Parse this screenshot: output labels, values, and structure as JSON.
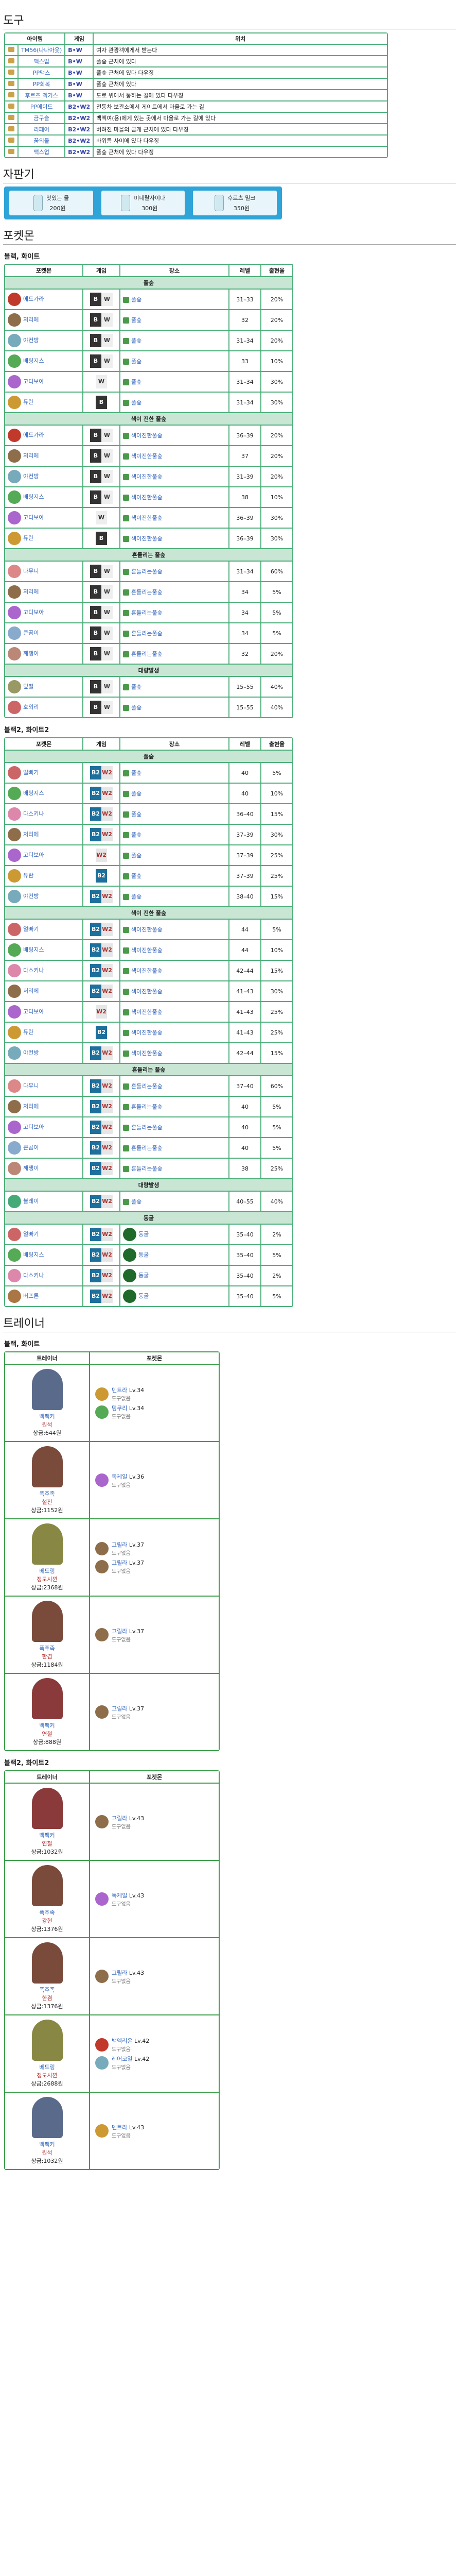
{
  "sections": {
    "items": "도구",
    "vending": "자판기",
    "pokemon": "포켓몬",
    "trainers": "트레이너"
  },
  "items": {
    "headers": [
      "아이템",
      "게임",
      "위치"
    ],
    "rows": [
      {
        "name": "TM56(나나아웃)",
        "game": "B•W",
        "loc": "여자 관광객에게서 받는다"
      },
      {
        "name": "맥스업",
        "game": "B•W",
        "loc": "풀숲 근처에 있다"
      },
      {
        "name": "PP맥스",
        "game": "B•W",
        "loc": "풀숲 근처에 있다 다우징"
      },
      {
        "name": "PP회복",
        "game": "B•W",
        "loc": "풀숲 근처에 있다"
      },
      {
        "name": "후르츠 엑기스",
        "game": "B•W",
        "loc": "도로 위에서 통하는 길에 있다 다우징"
      },
      {
        "name": "PP에이드",
        "game": "B2•W2",
        "loc": "전동차 보관소에서 게이트에서 마을로 가는 길"
      },
      {
        "name": "금구슬",
        "game": "B2•W2",
        "loc": "백엑여(용)에게 있는 곳에서 마을로 가는 길에 있다"
      },
      {
        "name": "리페어",
        "game": "B2•W2",
        "loc": "버려진 마을의 금개 근처에 있다 다우징"
      },
      {
        "name": "꿈의물",
        "game": "B2•W2",
        "loc": "바위틈 사이에 있다 다우징"
      },
      {
        "name": "맥스업",
        "game": "B2•W2",
        "loc": "풀숲 근처에 있다 다우징"
      }
    ]
  },
  "vending": [
    {
      "name": "맛있는 물",
      "price": "200원"
    },
    {
      "name": "미네랄사이다",
      "price": "300원"
    },
    {
      "name": "후르츠 밀크",
      "price": "350원"
    }
  ],
  "bw": {
    "title": "블랙, 화이트",
    "headers": [
      "포켓몬",
      "게임",
      "장소",
      "레벨",
      "출현율"
    ],
    "categories": [
      "풀숲",
      "색이 진한 풀숲",
      "흔들리는 풀숲",
      "대량발생"
    ],
    "rows": [
      {
        "cat": 0,
        "name": "에드가라",
        "game": "B•W",
        "place": "풀숲",
        "lv": "31–33",
        "rate": "20%",
        "color": "#c0392b"
      },
      {
        "cat": 0,
        "name": "저리에",
        "game": "B•W",
        "place": "풀숲",
        "lv": "32",
        "rate": "20%",
        "color": "#8e6e4a"
      },
      {
        "cat": 0,
        "name": "야컨방",
        "game": "B•W",
        "place": "풀숲",
        "lv": "31–34",
        "rate": "20%",
        "color": "#7ab"
      },
      {
        "cat": 0,
        "name": "배팅지스",
        "game": "B•W",
        "place": "풀숲",
        "lv": "33",
        "rate": "10%",
        "color": "#5a5"
      },
      {
        "cat": 0,
        "name": "고디보아",
        "game": "W",
        "place": "풀숲",
        "lv": "31–34",
        "rate": "30%",
        "color": "#a6c"
      },
      {
        "cat": 0,
        "name": "듀란",
        "game": "B",
        "place": "풀숲",
        "lv": "31–34",
        "rate": "30%",
        "color": "#c93"
      },
      {
        "cat": 1,
        "name": "에드가라",
        "game": "B•W",
        "place": "색이진한풀숲",
        "lv": "36–39",
        "rate": "20%",
        "color": "#c0392b"
      },
      {
        "cat": 1,
        "name": "저리에",
        "game": "B•W",
        "place": "색이진한풀숲",
        "lv": "37",
        "rate": "20%",
        "color": "#8e6e4a"
      },
      {
        "cat": 1,
        "name": "야컨방",
        "game": "B•W",
        "place": "색이진한풀숲",
        "lv": "31–39",
        "rate": "20%",
        "color": "#7ab"
      },
      {
        "cat": 1,
        "name": "배팅지스",
        "game": "B•W",
        "place": "색이진한풀숲",
        "lv": "38",
        "rate": "10%",
        "color": "#5a5"
      },
      {
        "cat": 1,
        "name": "고디보아",
        "game": "W",
        "place": "색이진한풀숲",
        "lv": "36–39",
        "rate": "30%",
        "color": "#a6c"
      },
      {
        "cat": 1,
        "name": "듀란",
        "game": "B",
        "place": "색이진한풀숲",
        "lv": "36–39",
        "rate": "30%",
        "color": "#c93"
      },
      {
        "cat": 2,
        "name": "다무니",
        "game": "B•W",
        "place": "흔들리는풀숲",
        "lv": "31–34",
        "rate": "60%",
        "color": "#d88"
      },
      {
        "cat": 2,
        "name": "저리에",
        "game": "B•W",
        "place": "흔들리는풀숲",
        "lv": "34",
        "rate": "5%",
        "color": "#8e6e4a"
      },
      {
        "cat": 2,
        "name": "고디보아",
        "game": "B•W",
        "place": "흔들리는풀숲",
        "lv": "34",
        "rate": "5%",
        "color": "#a6c"
      },
      {
        "cat": 2,
        "name": "큰곰이",
        "game": "B•W",
        "place": "흔들리는풀숲",
        "lv": "34",
        "rate": "5%",
        "color": "#8ac"
      },
      {
        "cat": 2,
        "name": "깨쟁이",
        "game": "B•W",
        "place": "흔들리는풀숲",
        "lv": "32",
        "rate": "20%",
        "color": "#b87"
      },
      {
        "cat": 3,
        "name": "덮철",
        "game": "B•W",
        "place": "풀숲",
        "lv": "15–55",
        "rate": "40%",
        "color": "#996"
      },
      {
        "cat": 3,
        "name": "호외리",
        "game": "B•W",
        "place": "풀숲",
        "lv": "15–55",
        "rate": "40%",
        "color": "#c66"
      }
    ]
  },
  "b2w2": {
    "title": "블랙2, 화이트2",
    "headers": [
      "포켓몬",
      "게임",
      "장소",
      "레벨",
      "출현율"
    ],
    "categories": [
      "풀숲",
      "색이 진한 풀숲",
      "흔들리는 풀숲",
      "대량발생",
      "동굴"
    ],
    "rows": [
      {
        "cat": 0,
        "name": "얼빠기",
        "game": "B2•W2",
        "place": "풀숲",
        "lv": "40",
        "rate": "5%",
        "color": "#c66"
      },
      {
        "cat": 0,
        "name": "배팅지스",
        "game": "B2•W2",
        "place": "풀숲",
        "lv": "40",
        "rate": "10%",
        "color": "#5a5"
      },
      {
        "cat": 0,
        "name": "다스키나",
        "game": "B2•W2",
        "place": "풀숲",
        "lv": "36–40",
        "rate": "15%",
        "color": "#d8a"
      },
      {
        "cat": 0,
        "name": "저리에",
        "game": "B2•W2",
        "place": "풀숲",
        "lv": "37–39",
        "rate": "30%",
        "color": "#8e6e4a"
      },
      {
        "cat": 0,
        "name": "고디보아",
        "game": "W2",
        "place": "풀숲",
        "lv": "37–39",
        "rate": "25%",
        "color": "#a6c"
      },
      {
        "cat": 0,
        "name": "듀란",
        "game": "B2",
        "place": "풀숲",
        "lv": "37–39",
        "rate": "25%",
        "color": "#c93"
      },
      {
        "cat": 0,
        "name": "야컨방",
        "game": "B2•W2",
        "place": "풀숲",
        "lv": "38–40",
        "rate": "15%",
        "color": "#7ab"
      },
      {
        "cat": 1,
        "name": "얼빠기",
        "game": "B2•W2",
        "place": "색이진한풀숲",
        "lv": "44",
        "rate": "5%",
        "color": "#c66"
      },
      {
        "cat": 1,
        "name": "배팅지스",
        "game": "B2•W2",
        "place": "색이진한풀숲",
        "lv": "44",
        "rate": "10%",
        "color": "#5a5"
      },
      {
        "cat": 1,
        "name": "다스키나",
        "game": "B2•W2",
        "place": "색이진한풀숲",
        "lv": "42–44",
        "rate": "15%",
        "color": "#d8a"
      },
      {
        "cat": 1,
        "name": "저리에",
        "game": "B2•W2",
        "place": "색이진한풀숲",
        "lv": "41–43",
        "rate": "30%",
        "color": "#8e6e4a"
      },
      {
        "cat": 1,
        "name": "고디보아",
        "game": "W2",
        "place": "색이진한풀숲",
        "lv": "41–43",
        "rate": "25%",
        "color": "#a6c"
      },
      {
        "cat": 1,
        "name": "듀란",
        "game": "B2",
        "place": "색이진한풀숲",
        "lv": "41–43",
        "rate": "25%",
        "color": "#c93"
      },
      {
        "cat": 1,
        "name": "야컨방",
        "game": "B2•W2",
        "place": "색이진한풀숲",
        "lv": "42–44",
        "rate": "15%",
        "color": "#7ab"
      },
      {
        "cat": 2,
        "name": "다무니",
        "game": "B2•W2",
        "place": "흔들리는풀숲",
        "lv": "37–40",
        "rate": "60%",
        "color": "#d88"
      },
      {
        "cat": 2,
        "name": "저리에",
        "game": "B2•W2",
        "place": "흔들리는풀숲",
        "lv": "40",
        "rate": "5%",
        "color": "#8e6e4a"
      },
      {
        "cat": 2,
        "name": "고디보아",
        "game": "B2•W2",
        "place": "흔들리는풀숲",
        "lv": "40",
        "rate": "5%",
        "color": "#a6c"
      },
      {
        "cat": 2,
        "name": "큰곰이",
        "game": "B2•W2",
        "place": "흔들리는풀숲",
        "lv": "40",
        "rate": "5%",
        "color": "#8ac"
      },
      {
        "cat": 2,
        "name": "깨쟁이",
        "game": "B2•W2",
        "place": "흔들리는풀숲",
        "lv": "38",
        "rate": "25%",
        "color": "#b87"
      },
      {
        "cat": 3,
        "name": "블레이",
        "game": "B2•W2",
        "place": "풀숲",
        "lv": "40–55",
        "rate": "40%",
        "color": "#4a7"
      },
      {
        "cat": 4,
        "name": "얼빠기",
        "game": "B2•W2",
        "place": "동굴",
        "lv": "35–40",
        "rate": "2%",
        "color": "#c66"
      },
      {
        "cat": 4,
        "name": "배팅지스",
        "game": "B2•W2",
        "place": "동굴",
        "lv": "35–40",
        "rate": "5%",
        "color": "#5a5"
      },
      {
        "cat": 4,
        "name": "다스키나",
        "game": "B2•W2",
        "place": "동굴",
        "lv": "35–40",
        "rate": "2%",
        "color": "#d8a"
      },
      {
        "cat": 4,
        "name": "버프론",
        "game": "B2•W2",
        "place": "동굴",
        "lv": "35–40",
        "rate": "5%",
        "color": "#a74"
      }
    ]
  },
  "trainers_bw": {
    "title": "블랙, 화이트",
    "headers": [
      "트레이너",
      "포켓몬"
    ],
    "rows": [
      {
        "cls": "백팩커",
        "name": "원석",
        "prize": "상금:644원",
        "color": "#5a6a8a",
        "mons": [
          {
            "n": "덴트라",
            "lv": "Lv.34",
            "h": "도구없음",
            "c": "#c93"
          },
          {
            "n": "덩쿠리",
            "lv": "Lv.34",
            "h": "도구없음",
            "c": "#5a5"
          }
        ]
      },
      {
        "cls": "폭주족",
        "name": "철진",
        "prize": "상금:1152원",
        "color": "#7a4a3a",
        "mons": [
          {
            "n": "독케일",
            "lv": "Lv.36",
            "h": "도구없음",
            "c": "#a6c"
          }
        ]
      },
      {
        "cls": "베드링",
        "name": "정도시낀",
        "prize": "상금:2368원",
        "color": "#884",
        "mons": [
          {
            "n": "고릴라",
            "lv": "Lv.37",
            "h": "도구없음",
            "c": "#8e6e4a"
          },
          {
            "n": "고릴라",
            "lv": "Lv.37",
            "h": "도구없음",
            "c": "#8e6e4a"
          }
        ]
      },
      {
        "cls": "폭주족",
        "name": "한겸",
        "prize": "상금:1184원",
        "color": "#7a4a3a",
        "mons": [
          {
            "n": "고릴라",
            "lv": "Lv.37",
            "h": "도구없음",
            "c": "#8e6e4a"
          }
        ]
      },
      {
        "cls": "백팩커",
        "name": "연철",
        "prize": "상금:888원",
        "color": "#8a3a3a",
        "mons": [
          {
            "n": "고릴라",
            "lv": "Lv.37",
            "h": "도구없음",
            "c": "#8e6e4a"
          }
        ]
      }
    ]
  },
  "trainers_b2w2": {
    "title": "블랙2, 화이트2",
    "headers": [
      "트레이너",
      "포켓몬"
    ],
    "rows": [
      {
        "cls": "백팩커",
        "name": "연철",
        "prize": "상금:1032원",
        "color": "#8a3a3a",
        "mons": [
          {
            "n": "고릴라",
            "lv": "Lv.43",
            "h": "도구없음",
            "c": "#8e6e4a"
          }
        ]
      },
      {
        "cls": "폭주족",
        "name": "강현",
        "prize": "상금:1376원",
        "color": "#7a4a3a",
        "mons": [
          {
            "n": "독케일",
            "lv": "Lv.43",
            "h": "도구없음",
            "c": "#a6c"
          }
        ]
      },
      {
        "cls": "폭주족",
        "name": "한겸",
        "prize": "상금:1376원",
        "color": "#7a4a3a",
        "mons": [
          {
            "n": "고릴라",
            "lv": "Lv.43",
            "h": "도구없음",
            "c": "#8e6e4a"
          }
        ]
      },
      {
        "cls": "베드링",
        "name": "정도시낀",
        "prize": "상금:2688원",
        "color": "#884",
        "mons": [
          {
            "n": "백엑리온",
            "lv": "Lv.42",
            "h": "도구없음",
            "c": "#c0392b"
          },
          {
            "n": "레어코일",
            "lv": "Lv.42",
            "h": "도구없음",
            "c": "#7ab"
          }
        ]
      },
      {
        "cls": "백팩커",
        "name": "원석",
        "prize": "상금:1032원",
        "color": "#5a6a8a",
        "mons": [
          {
            "n": "덴트라",
            "lv": "Lv.43",
            "h": "도구없음",
            "c": "#c93"
          }
        ]
      }
    ]
  }
}
